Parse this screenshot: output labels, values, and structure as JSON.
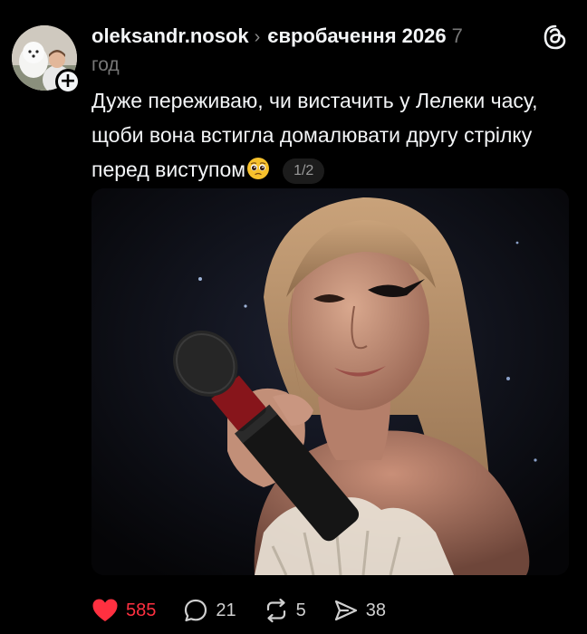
{
  "post": {
    "username": "oleksandr.nosok",
    "topic": "євробачення 2026",
    "time_value": "7",
    "time_unit": "год",
    "text": "Дуже переживаю, чи вистачить у Лелеки часу, щоби вона встигла домалювати другу стрілку перед виступом",
    "emoji": "pleading-face-emoji",
    "page_indicator": "1/2",
    "follow_symbol": "+"
  },
  "actions": {
    "likes": "585",
    "replies": "21",
    "reposts": "5",
    "shares": "38"
  },
  "colors": {
    "background": "#000000",
    "text": "#f3f5f7",
    "muted": "#777777",
    "like": "#ff3040"
  },
  "icons": [
    "threads-logo-icon",
    "heart-icon",
    "reply-icon",
    "repost-icon",
    "share-icon"
  ]
}
